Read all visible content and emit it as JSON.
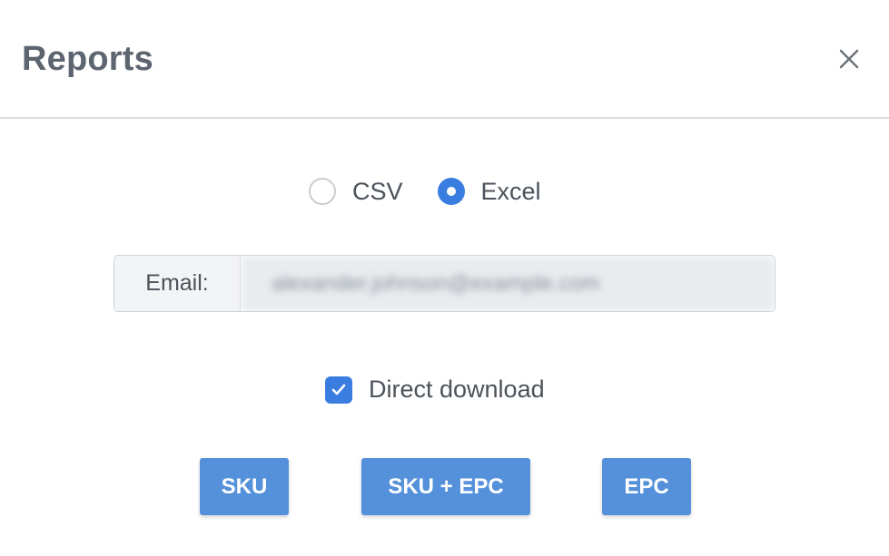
{
  "modal": {
    "title": "Reports",
    "close_icon": "close-icon"
  },
  "format": {
    "options": [
      {
        "label": "CSV",
        "selected": false
      },
      {
        "label": "Excel",
        "selected": true
      }
    ]
  },
  "email": {
    "label": "Email:",
    "value": "alexander.johnson@example.com"
  },
  "direct_download": {
    "label": "Direct download",
    "checked": true
  },
  "buttons": {
    "sku": "SKU",
    "sku_epc": "SKU + EPC",
    "epc": "EPC"
  },
  "colors": {
    "accent": "#3a7de0",
    "button": "#5591db",
    "title": "#5d6570"
  }
}
